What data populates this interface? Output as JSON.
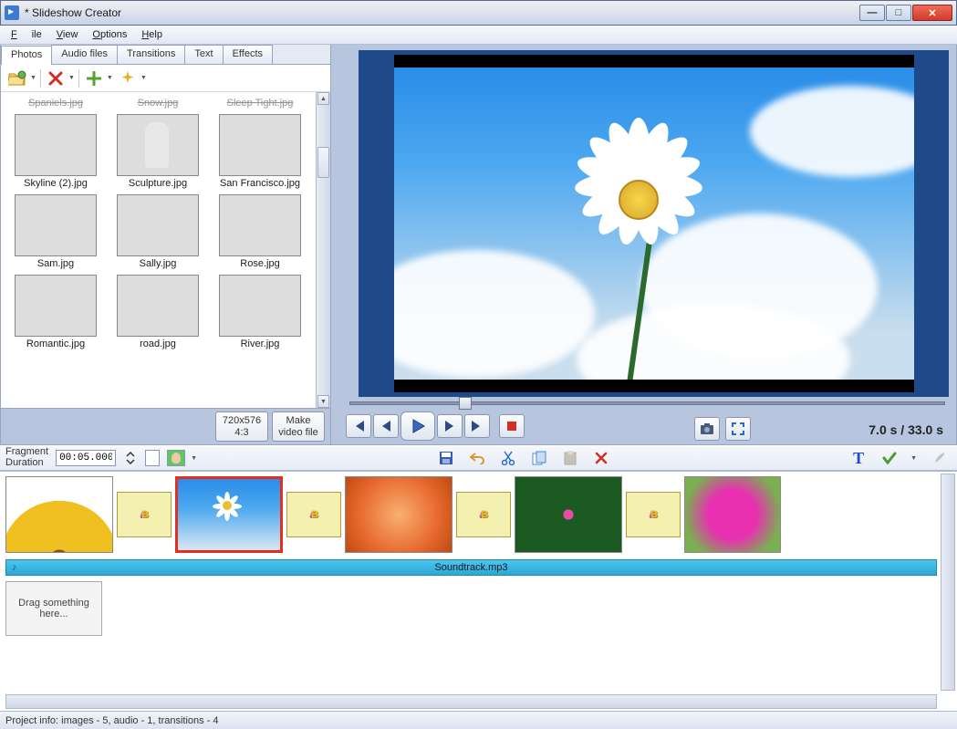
{
  "window": {
    "title": " *  Slideshow Creator",
    "min": "—",
    "max": "□",
    "close": "✕"
  },
  "menu": {
    "file": "File",
    "view": "View",
    "options": "Options",
    "help": "Help"
  },
  "tabs": {
    "photos": "Photos",
    "audio": "Audio files",
    "transitions": "Transitions",
    "text": "Text",
    "effects": "Effects"
  },
  "photos_toolbar": {
    "open": "open-folder-icon",
    "delete": "delete-icon",
    "add": "add-icon",
    "effect": "sparkle-icon"
  },
  "thumbs": {
    "row0": [
      {
        "label": "Spaniels.jpg"
      },
      {
        "label": "Snow.jpg"
      },
      {
        "label": "Sleep Tight.jpg"
      }
    ],
    "row1": [
      {
        "label": "Skyline (2).jpg"
      },
      {
        "label": "Sculpture.jpg"
      },
      {
        "label": "San Francisco.jpg"
      }
    ],
    "row2": [
      {
        "label": "Sam.jpg"
      },
      {
        "label": "Sally.jpg"
      },
      {
        "label": "Rose.jpg"
      }
    ],
    "row3": [
      {
        "label": "Romantic.jpg"
      },
      {
        "label": "road.jpg"
      },
      {
        "label": "River.jpg"
      }
    ]
  },
  "leftbot": {
    "res1": "720x576",
    "res2": "4:3",
    "make1": "Make",
    "make2": "video file"
  },
  "player": {
    "time": "7.0 s  / 33.0 s"
  },
  "midbar": {
    "frag1": "Fragment",
    "frag2": "Duration",
    "dur_value": "00:05.000",
    "text_tool": "T"
  },
  "timeline": {
    "audio_file": "Soundtrack.mp3",
    "dropzone": "Drag something here..."
  },
  "status": "Project info: images - 5, audio - 1, transitions - 4"
}
